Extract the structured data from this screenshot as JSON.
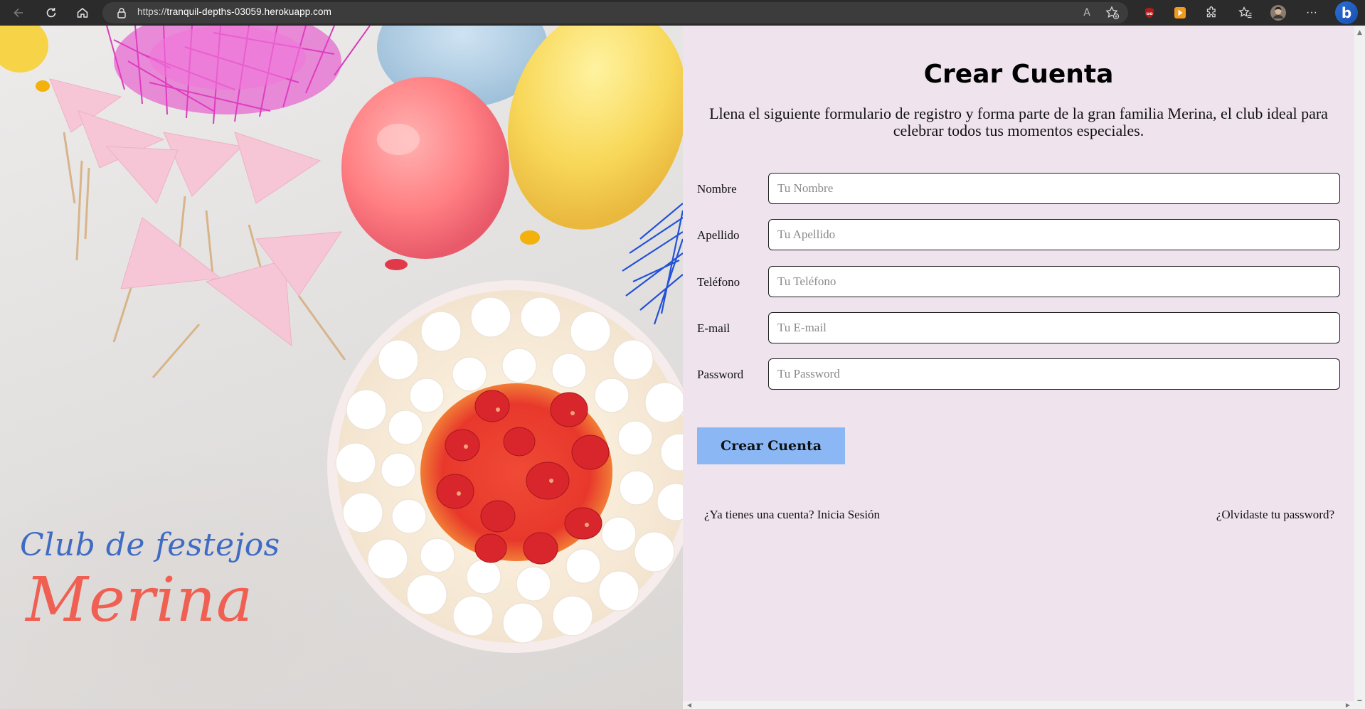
{
  "browser": {
    "url_scheme": "https://",
    "url_host": "tranquil-depths-03059.herokuapp.com",
    "nav_icons": [
      "back-icon",
      "refresh-icon",
      "home-icon"
    ],
    "toolbar_icons": [
      "read-aloud-icon",
      "add-favorite-icon",
      "ublock-icon",
      "extension-orange-icon",
      "extensions-icon",
      "favorites-icon",
      "profile-avatar",
      "more-icon",
      "bing-icon"
    ],
    "read_aloud_glyph": "A",
    "ublock_glyph": "uo",
    "more_glyph": "···",
    "bing_glyph": "b"
  },
  "hero": {
    "brand_line1": "Club de festejos",
    "brand_line2": "Merina"
  },
  "form": {
    "title": "Crear Cuenta",
    "subtitle": "Llena el siguiente formulario de registro y forma parte de la gran familia Merina, el club ideal para celebrar todos tus momentos especiales.",
    "fields": [
      {
        "label": "Nombre",
        "placeholder": "Tu Nombre",
        "value": ""
      },
      {
        "label": "Apellido",
        "placeholder": "Tu Apellido",
        "value": ""
      },
      {
        "label": "Teléfono",
        "placeholder": "Tu Teléfono",
        "value": ""
      },
      {
        "label": "E-mail",
        "placeholder": "Tu E-mail",
        "value": ""
      },
      {
        "label": "Password",
        "placeholder": "Tu Password",
        "value": ""
      }
    ],
    "submit_label": "Crear Cuenta",
    "login_link": "¿Ya tienes una cuenta? Inicia Sesión",
    "forgot_link": "¿Olvidaste tu password?"
  },
  "colors": {
    "panel_bg": "#efe4ee",
    "button_bg": "#8bb8f5",
    "brand_blue": "#3f6bc4",
    "brand_coral": "#f06052"
  }
}
